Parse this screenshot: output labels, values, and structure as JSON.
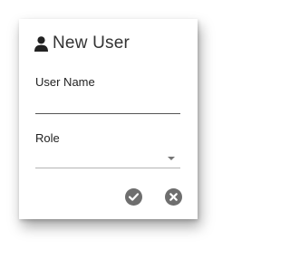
{
  "dialog": {
    "title": "New User",
    "icon": "user-icon"
  },
  "form": {
    "username_label": "User Name",
    "username_value": "",
    "role_label": "Role",
    "role_value": ""
  },
  "actions": {
    "confirm_icon": "check-circle-icon",
    "cancel_icon": "close-circle-icon"
  },
  "colors": {
    "text": "#333333",
    "icon_gray": "#6e6e6e",
    "underline_active": "#555555",
    "underline_inactive": "#b5b5b5"
  }
}
